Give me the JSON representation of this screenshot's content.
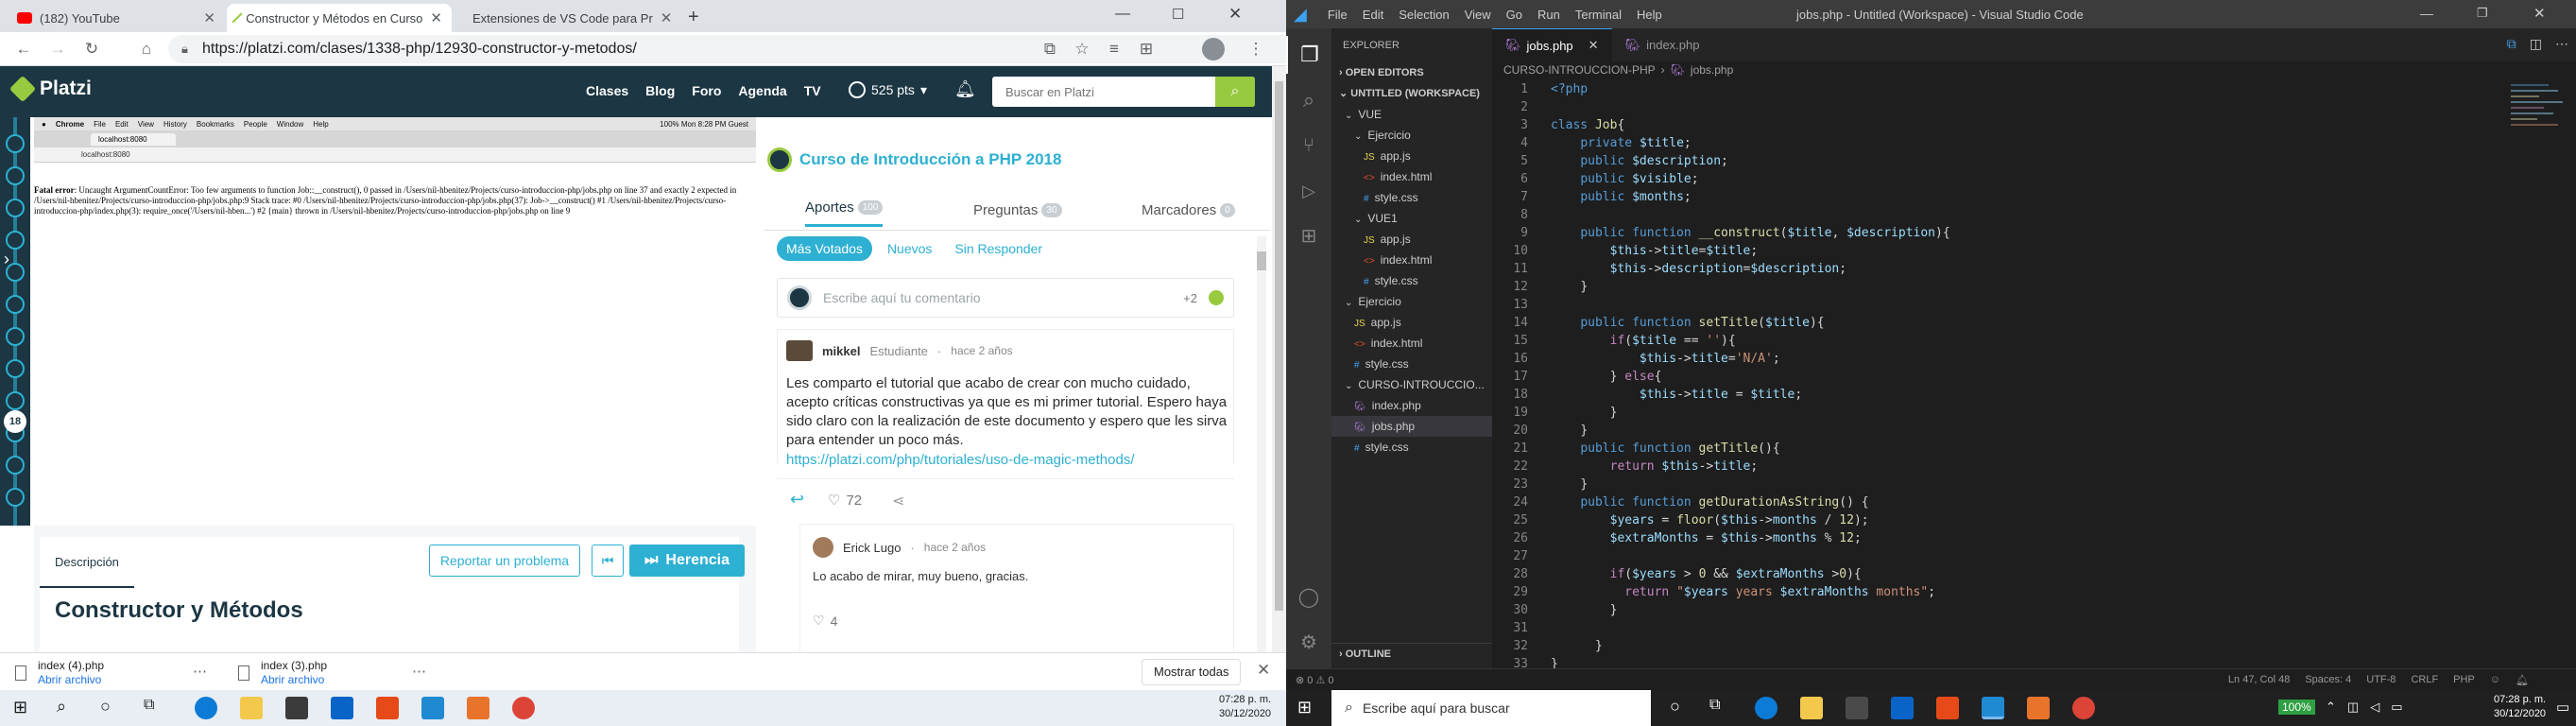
{
  "browser": {
    "tabs": [
      {
        "title": "(182) YouTube",
        "icon": "youtube-icon"
      },
      {
        "title": "Constructor y Métodos en Curso",
        "icon": "platzi-icon"
      },
      {
        "title": "Extensiones de VS Code para Pr",
        "icon": "platzi-icon"
      }
    ],
    "url": "https://platzi.com/clases/1338-php/12930-constructor-y-metodos/"
  },
  "platzi": {
    "logo": "Platzi",
    "nav": [
      "Clases",
      "Blog",
      "Foro",
      "Agenda",
      "TV"
    ],
    "points": "525 pts",
    "search_placeholder": "Buscar en Platzi",
    "timeline_current": "18",
    "video": {
      "mac_menu": [
        "Chrome",
        "File",
        "Edit",
        "View",
        "History",
        "Bookmarks",
        "People",
        "Window",
        "Help"
      ],
      "mac_status": "100%  Mon 8:28 PM  Guest",
      "tab_label": "localhost:8080",
      "url": "localhost:8080",
      "error_label": "Fatal error",
      "error_text": ": Uncaught ArgumentCountError: Too few arguments to function Job::__construct(), 0 passed in /Users/nil-hbenitez/Projects/curso-introduccion-php/jobs.php on line 37 and exactly 2 expected in /Users/nil-hbenitez/Projects/curso-introduccion-php/jobs.php:9 Stack trace: #0 /Users/nil-hbenitez/Projects/curso-introduccion-php/jobs.php(37): Job->__construct() #1 /Users/nil-hbenitez/Projects/curso-introduccion-php/index.php(3): require_once('/Users/nil-hben...') #2 {main} thrown in /Users/nil-hbenitez/Projects/curso-introduccion-php/jobs.php on line 9"
    },
    "bottom": {
      "desc_tab": "Descripción",
      "report": "Reportar un problema",
      "next": "Herencia",
      "title": "Constructor y Métodos"
    },
    "course": {
      "title": "Curso de Introducción a PHP 2018",
      "tabs": [
        {
          "label": "Aportes",
          "count": "100"
        },
        {
          "label": "Preguntas",
          "count": "30"
        },
        {
          "label": "Marcadores",
          "count": "0"
        }
      ],
      "filters": [
        "Más Votados",
        "Nuevos",
        "Sin Responder"
      ],
      "comment_placeholder": "Escribe aquí tu comentario",
      "comment_points": "+2",
      "comments": [
        {
          "author": "mikkel",
          "role": "Estudiante",
          "time": "hace 2 años",
          "body": "Les comparto el tutorial que acabo de crear con mucho cuidado, acepto críticas constructivas ya que es mi primer tutorial. Espero haya sido claro con la realización de este documento y espero que les sirva para entender un poco más.",
          "link": "https://platzi.com/php/tutoriales/uso-de-magic-methods/",
          "likes": "72"
        },
        {
          "author": "Erick Lugo",
          "time": "hace 2 años",
          "body": "Lo acabo de mirar, muy bueno, gracias.",
          "likes": "4"
        }
      ]
    }
  },
  "downloads": {
    "items": [
      {
        "name": "index (4).php",
        "action": "Abrir archivo"
      },
      {
        "name": "index (3).php",
        "action": "Abrir archivo"
      }
    ],
    "show_all": "Mostrar todas"
  },
  "vscode": {
    "menu": [
      "File",
      "Edit",
      "Selection",
      "View",
      "Go",
      "Run",
      "Terminal",
      "Help"
    ],
    "title": "jobs.php - Untitled (Workspace) - Visual Studio Code",
    "explorer_title": "EXPLORER",
    "open_editors": "OPEN EDITORS",
    "workspace": "UNTITLED (WORKSPACE)",
    "tree": [
      {
        "label": "VUE",
        "depth": 1,
        "kind": "folder"
      },
      {
        "label": "Ejercicio",
        "depth": 2,
        "kind": "folder"
      },
      {
        "label": "app.js",
        "depth": 3,
        "kind": "js"
      },
      {
        "label": "index.html",
        "depth": 3,
        "kind": "html"
      },
      {
        "label": "style.css",
        "depth": 3,
        "kind": "css"
      },
      {
        "label": "VUE1",
        "depth": 2,
        "kind": "folder"
      },
      {
        "label": "app.js",
        "depth": 3,
        "kind": "js"
      },
      {
        "label": "index.html",
        "depth": 3,
        "kind": "html"
      },
      {
        "label": "style.css",
        "depth": 3,
        "kind": "css"
      },
      {
        "label": "Ejercicio",
        "depth": 1,
        "kind": "folder"
      },
      {
        "label": "app.js",
        "depth": 2,
        "kind": "js"
      },
      {
        "label": "index.html",
        "depth": 2,
        "kind": "html"
      },
      {
        "label": "style.css",
        "depth": 2,
        "kind": "css"
      },
      {
        "label": "CURSO-INTROUCCIO...",
        "depth": 1,
        "kind": "folder"
      },
      {
        "label": "index.php",
        "depth": 2,
        "kind": "php"
      },
      {
        "label": "jobs.php",
        "depth": 2,
        "kind": "php",
        "selected": true
      },
      {
        "label": "style.css",
        "depth": 2,
        "kind": "css"
      }
    ],
    "outline": "OUTLINE",
    "tabs": [
      {
        "label": "jobs.php",
        "active": true
      },
      {
        "label": "index.php",
        "active": false
      }
    ],
    "breadcrumb": [
      "CURSO-INTROUCCION-PHP",
      "jobs.php"
    ],
    "line_numbers": [
      "1",
      "2",
      "3",
      "4",
      "5",
      "6",
      "7",
      "8",
      "9",
      "10",
      "11",
      "12",
      "13",
      "14",
      "15",
      "16",
      "17",
      "18",
      "19",
      "20",
      "21",
      "22",
      "23",
      "24",
      "25",
      "26",
      "27",
      "28",
      "29",
      "30",
      "31",
      "32",
      "33"
    ],
    "status_left": "⊗ 0 ⚠ 0",
    "status_right": [
      "Ln 47, Col 48",
      "Spaces: 4",
      "UTF-8",
      "CRLF",
      "PHP"
    ]
  },
  "taskbar_left": {
    "time": "07:28 p. m.",
    "date": "30/12/2020"
  },
  "taskbar_right": {
    "search": "Escribe aquí para buscar",
    "battery": "100%",
    "time": "07:28 p. m.",
    "date": "30/12/2020"
  },
  "colors": {
    "platzi_dark": "#1c3643",
    "platzi_green": "#98ca3f",
    "platzi_blue": "#2db0d2",
    "vscode_bg": "#1e1e1e"
  }
}
